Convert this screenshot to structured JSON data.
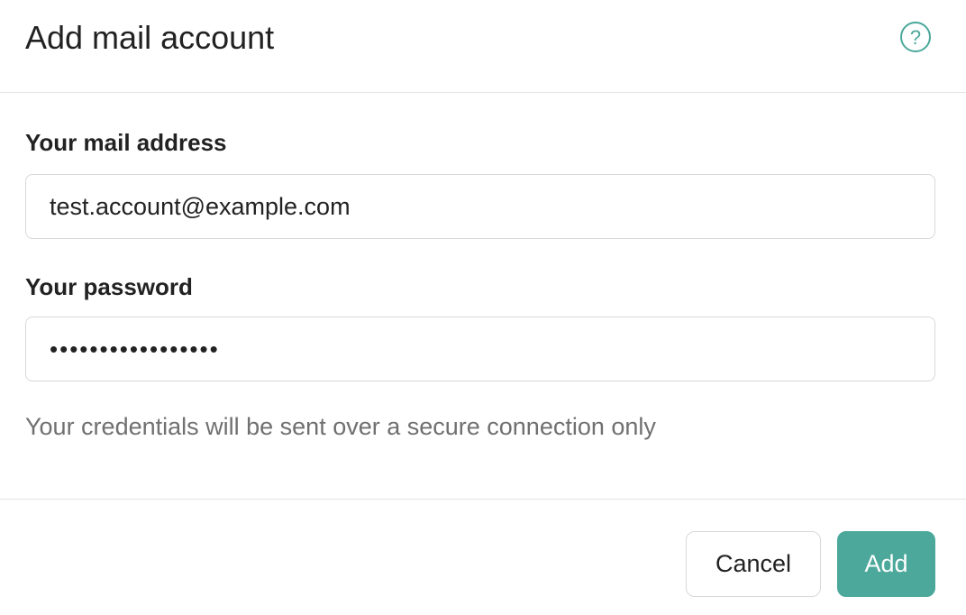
{
  "dialog": {
    "title": "Add mail account",
    "help_icon": "question-circle-icon",
    "help_glyph": "?"
  },
  "form": {
    "email": {
      "label": "Your mail address",
      "value": "test.account@example.com"
    },
    "password": {
      "label": "Your password",
      "masked_value": "•••••••••••••••••"
    },
    "hint": "Your credentials will be sent over a secure connection only"
  },
  "footer": {
    "cancel_label": "Cancel",
    "add_label": "Add"
  },
  "colors": {
    "accent": "#4ba89a",
    "hint_text": "#707070",
    "border": "#d8d8d8"
  }
}
